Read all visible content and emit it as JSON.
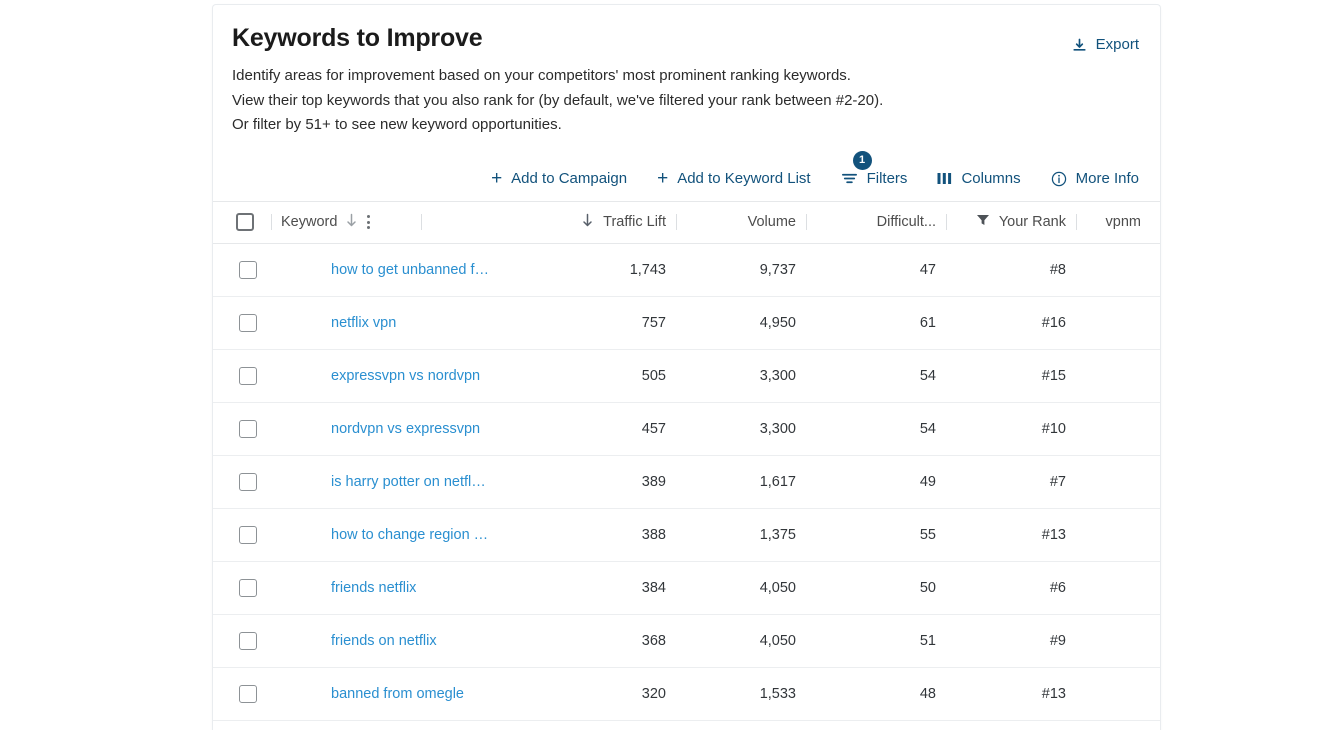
{
  "card": {
    "title": "Keywords to Improve",
    "description_lines": [
      "Identify areas for improvement based on your competitors' most prominent ranking keywords.",
      "View their top keywords that you also rank for (by default, we've filtered your rank between #2-20).",
      "Or filter by 51+ to see new keyword opportunities."
    ],
    "export_label": "Export",
    "export_icon": "download-icon"
  },
  "toolbar": {
    "add_to_campaign": "Add to Campaign",
    "add_to_keyword_list": "Add to Keyword List",
    "filters_label": "Filters",
    "filters_badge": "1",
    "columns_label": "Columns",
    "more_info_label": "More Info",
    "plus_glyph": "+"
  },
  "table": {
    "headers": {
      "keyword": "Keyword",
      "traffic_lift": "Traffic Lift",
      "volume": "Volume",
      "difficulty": "Difficult...",
      "your_rank": "Your Rank",
      "vpnm": "vpnm"
    },
    "rows": [
      {
        "keyword": "how to get unbanned f…",
        "traffic_lift": "1,743",
        "volume": "9,737",
        "difficulty": "47",
        "your_rank": "#8",
        "vpnm": ""
      },
      {
        "keyword": "netflix vpn",
        "traffic_lift": "757",
        "volume": "4,950",
        "difficulty": "61",
        "your_rank": "#16",
        "vpnm": ""
      },
      {
        "keyword": "expressvpn vs nordvpn",
        "traffic_lift": "505",
        "volume": "3,300",
        "difficulty": "54",
        "your_rank": "#15",
        "vpnm": ""
      },
      {
        "keyword": "nordvpn vs expressvpn",
        "traffic_lift": "457",
        "volume": "3,300",
        "difficulty": "54",
        "your_rank": "#10",
        "vpnm": ""
      },
      {
        "keyword": "is harry potter on netfl…",
        "traffic_lift": "389",
        "volume": "1,617",
        "difficulty": "49",
        "your_rank": "#7",
        "vpnm": ""
      },
      {
        "keyword": "how to change region …",
        "traffic_lift": "388",
        "volume": "1,375",
        "difficulty": "55",
        "your_rank": "#13",
        "vpnm": ""
      },
      {
        "keyword": "friends netflix",
        "traffic_lift": "384",
        "volume": "4,050",
        "difficulty": "50",
        "your_rank": "#6",
        "vpnm": ""
      },
      {
        "keyword": "friends on netflix",
        "traffic_lift": "368",
        "volume": "4,050",
        "difficulty": "51",
        "your_rank": "#9",
        "vpnm": ""
      },
      {
        "keyword": "banned from omegle",
        "traffic_lift": "320",
        "volume": "1,533",
        "difficulty": "48",
        "your_rank": "#13",
        "vpnm": ""
      }
    ]
  },
  "colors": {
    "accent": "#12527c",
    "link": "#2a8fd0",
    "text": "#32363a",
    "muted": "#4d4d4d",
    "border": "#e6e8ea"
  }
}
